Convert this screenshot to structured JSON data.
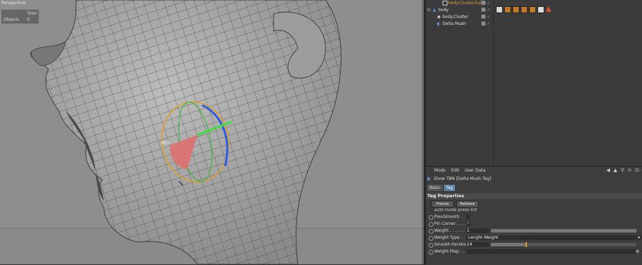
{
  "viewport": {
    "label": "Perspective",
    "hud": {
      "col_header": "Total",
      "row_label": "Objects",
      "row_value": "0"
    },
    "gizmo_value": "20.0"
  },
  "object_manager": {
    "rows": [
      {
        "name": "body.Cluster.hull",
        "color": "#e8a040"
      },
      {
        "name": "body",
        "color": "#e0e0e0"
      },
      {
        "name": "body.Cluster",
        "color": "#e0e0e0"
      },
      {
        "name": "Delta Mush",
        "color": "#e0e0e0"
      }
    ]
  },
  "attributes": {
    "menu": [
      "Mode",
      "Edit",
      "User Data"
    ],
    "show_line": "Show TBN  [Delta Mush Tag]",
    "tabs": [
      "Basic",
      "Tag"
    ],
    "active_tab": "Tag",
    "section_title": "Tag Properties",
    "buttons": {
      "freeze": "Freeze",
      "release": "Release"
    },
    "info_text": "auto mode press init",
    "params": {
      "prev_smooth": {
        "label": "PrevSmooth . . . . .",
        "checked": ""
      },
      "pin_corner": {
        "label": "Pin Corner . . . . .",
        "checked": "✓"
      },
      "weight": {
        "label": "Weight . . . . . . . .",
        "value": "1",
        "fraction": 1.0
      },
      "weight_type": {
        "label": "Weight Type . . . .",
        "value": "Lenght Weight"
      },
      "smooth_iteration": {
        "label": "Smooth Iteration",
        "value": "24",
        "fraction": 0.24
      },
      "weight_map": {
        "label": "Weight Map . . . . ."
      }
    }
  },
  "colors": {
    "accent": "#5d7fa8",
    "slider_knob": "#e0a020"
  }
}
